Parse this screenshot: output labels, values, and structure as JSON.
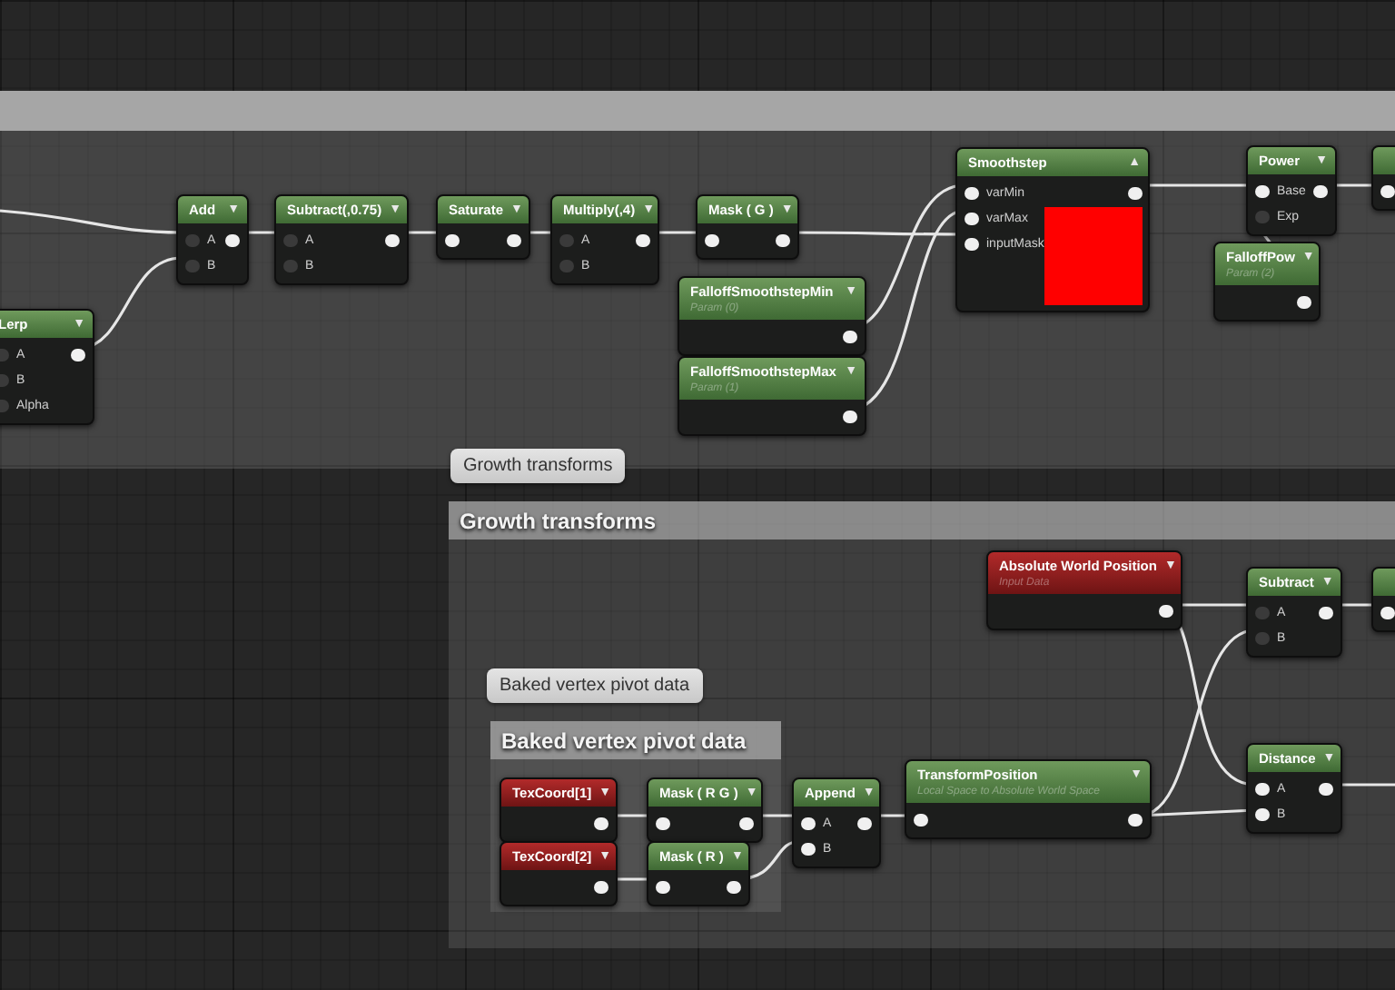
{
  "comments": [
    {
      "bubble": "Growth transforms",
      "title": "Growth transforms"
    },
    {
      "bubble": "Baked vertex pivot data",
      "title": "Baked vertex pivot data"
    }
  ],
  "nodes": [
    {
      "title": "Smoothstep",
      "kind": "function",
      "toggle": "▲",
      "inputs": [
        {
          "label": "varMin",
          "connected": true
        },
        {
          "label": "varMax",
          "connected": true
        },
        {
          "label": "inputMask",
          "connected": true
        }
      ],
      "output": true,
      "color": "#ff0000"
    },
    {
      "title": "Power",
      "kind": "function",
      "toggle": "▼",
      "inputs": [
        {
          "label": "Base",
          "connected": true
        },
        {
          "label": "Exp",
          "connected": false
        }
      ],
      "output": true
    },
    {
      "kind": "function",
      "inputs": [
        {
          "connected": true
        }
      ]
    },
    {
      "title": "Add",
      "kind": "function",
      "toggle": "▼",
      "inputs": [
        {
          "label": "A",
          "connected": false
        },
        {
          "label": "B",
          "connected": false
        }
      ],
      "output": true
    },
    {
      "title": "Subtract(,0.75)",
      "kind": "function",
      "toggle": "▼",
      "inputs": [
        {
          "label": "A",
          "connected": false
        },
        {
          "label": "B",
          "connected": false
        }
      ],
      "output": true
    },
    {
      "title": "Saturate",
      "kind": "function",
      "toggle": "▼",
      "inputs": [
        {
          "connected": true
        }
      ],
      "output": true
    },
    {
      "title": "Multiply(,4)",
      "kind": "function",
      "toggle": "▼",
      "inputs": [
        {
          "label": "A",
          "connected": false
        },
        {
          "label": "B",
          "connected": false
        }
      ],
      "output": true
    },
    {
      "title": "Mask ( G )",
      "kind": "function",
      "toggle": "▼",
      "inputs": [
        {
          "connected": true
        }
      ],
      "output": true
    },
    {
      "title": "FalloffPow",
      "subtitle": "Param (2)",
      "kind": "function",
      "toggle": "▼",
      "output": true
    },
    {
      "title": "FalloffSmoothstepMin",
      "subtitle": "Param (0)",
      "kind": "function",
      "toggle": "▼",
      "output": true
    },
    {
      "title": "Lerp",
      "kind": "function",
      "toggle": "▼",
      "inputs": [
        {
          "label": "A",
          "connected": false
        },
        {
          "label": "B",
          "connected": false
        },
        {
          "label": "Alpha",
          "connected": false
        }
      ],
      "output": true
    },
    {
      "title": "FalloffSmoothstepMax",
      "subtitle": "Param (1)",
      "kind": "function",
      "toggle": "▼",
      "output": true
    },
    {
      "title": "Absolute World Position",
      "subtitle": "Input Data",
      "kind": "input",
      "toggle": "▼",
      "output": true
    },
    {
      "title": "Subtract",
      "kind": "function",
      "toggle": "▼",
      "inputs": [
        {
          "label": "A",
          "connected": false
        },
        {
          "label": "B",
          "connected": false
        }
      ],
      "output": true
    },
    {
      "kind": "function",
      "inputs": [
        {
          "connected": true
        }
      ]
    },
    {
      "title": "TransformPosition",
      "subtitle": "Local Space to Absolute World Space",
      "kind": "function",
      "toggle": "▼",
      "inputs": [
        {
          "connected": true
        }
      ],
      "output": true
    },
    {
      "title": "Distance",
      "kind": "function",
      "toggle": "▼",
      "inputs": [
        {
          "label": "A",
          "connected": true
        },
        {
          "label": "B",
          "connected": true
        }
      ],
      "output": true
    },
    {
      "title": "TexCoord[1]",
      "kind": "input",
      "toggle": "▼",
      "output": true
    },
    {
      "title": "Mask ( R G )",
      "kind": "function",
      "toggle": "▼",
      "inputs": [
        {
          "connected": true
        }
      ],
      "output": true
    },
    {
      "title": "Append",
      "kind": "function",
      "toggle": "▼",
      "inputs": [
        {
          "label": "A",
          "connected": true
        },
        {
          "label": "B",
          "connected": true
        }
      ],
      "output": true
    },
    {
      "title": "TexCoord[2]",
      "kind": "input",
      "toggle": "▼",
      "output": true
    },
    {
      "title": "Mask ( R )",
      "kind": "function",
      "toggle": "▼",
      "inputs": [
        {
          "connected": true
        }
      ],
      "output": true
    }
  ]
}
